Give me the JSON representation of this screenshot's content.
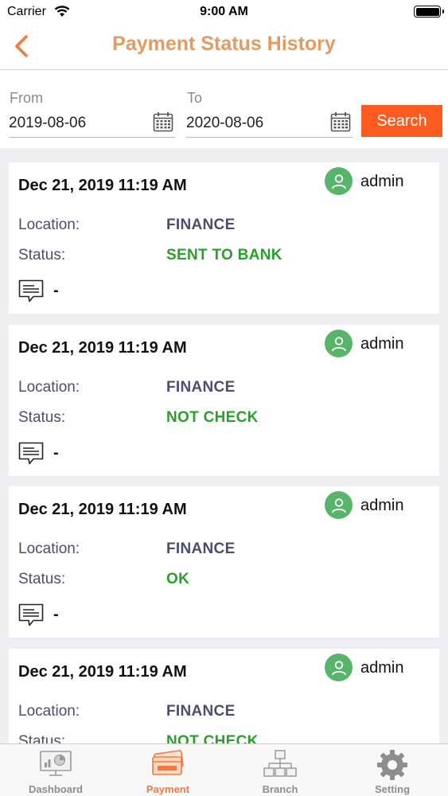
{
  "status_bar": {
    "carrier": "Carrier",
    "time": "9:00 AM"
  },
  "header": {
    "title": "Payment Status History",
    "back_icon": "chevron-left-icon"
  },
  "filter": {
    "from_label": "From",
    "from_value": "2019-08-06",
    "to_label": "To",
    "to_value": "2020-08-06",
    "search_label": "Search"
  },
  "colors": {
    "accent": "#fc5b1f",
    "title": "#e39b62",
    "status_green": "#2aa02a",
    "avatar_green": "#58b46a"
  },
  "labels": {
    "location": "Location:",
    "status": "Status:"
  },
  "records": [
    {
      "datetime": "Dec 21, 2019 11:19 AM",
      "user": "admin",
      "location": "FINANCE",
      "status": "SENT TO BANK",
      "note": "-"
    },
    {
      "datetime": "Dec 21, 2019 11:19 AM",
      "user": "admin",
      "location": "FINANCE",
      "status": "NOT CHECK",
      "note": "-"
    },
    {
      "datetime": "Dec 21, 2019 11:19 AM",
      "user": "admin",
      "location": "FINANCE",
      "status": "OK",
      "note": "-"
    },
    {
      "datetime": "Dec 21, 2019 11:19 AM",
      "user": "admin",
      "location": "FINANCE",
      "status": "NOT CHECK",
      "note": "-"
    }
  ],
  "tabs": [
    {
      "label": "Dashboard",
      "icon": "dashboard-icon"
    },
    {
      "label": "Payment",
      "icon": "payment-icon",
      "active": true
    },
    {
      "label": "Branch",
      "icon": "branch-icon"
    },
    {
      "label": "Setting",
      "icon": "gear-icon"
    }
  ]
}
